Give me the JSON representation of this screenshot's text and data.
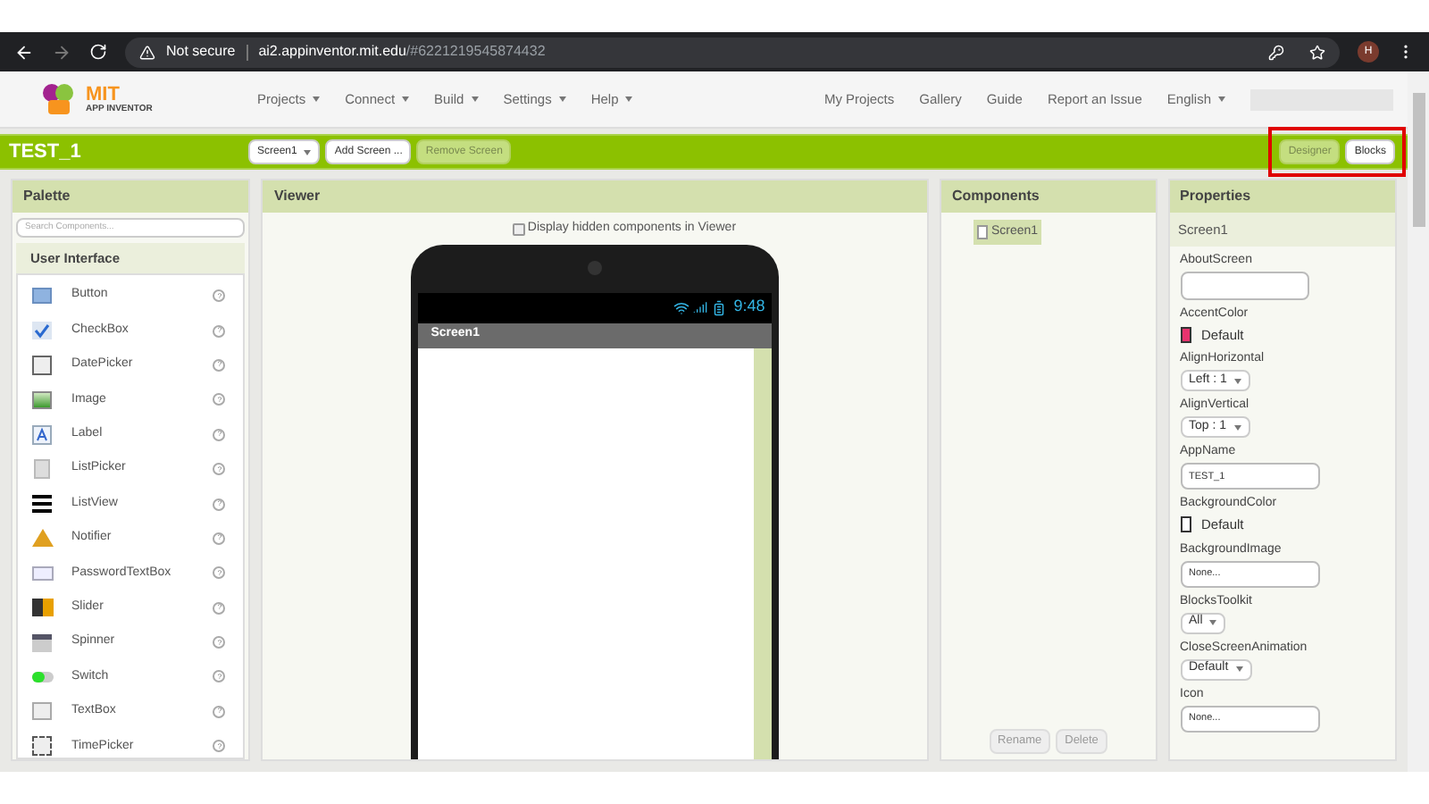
{
  "browser": {
    "security": "Not secure",
    "url_host": "ai2.appinventor.mit.edu",
    "url_rest": "/#6221219545874432",
    "avatar": "H"
  },
  "logo": {
    "title": "MIT",
    "subtitle": "APP INVENTOR"
  },
  "menu": [
    {
      "label": "Projects",
      "dropdown": true
    },
    {
      "label": "Connect",
      "dropdown": true
    },
    {
      "label": "Build",
      "dropdown": true
    },
    {
      "label": "Settings",
      "dropdown": true
    },
    {
      "label": "Help",
      "dropdown": true
    }
  ],
  "links": [
    {
      "label": "My Projects",
      "dropdown": false
    },
    {
      "label": "Gallery",
      "dropdown": false
    },
    {
      "label": "Guide",
      "dropdown": false
    },
    {
      "label": "Report an Issue",
      "dropdown": false
    },
    {
      "label": "English",
      "dropdown": true
    }
  ],
  "project": {
    "title": "TEST_1",
    "screen_select": "Screen1",
    "buttons": [
      {
        "label": "Add Screen ...",
        "disabled": false
      },
      {
        "label": "Remove Screen",
        "disabled": true
      }
    ],
    "modes": [
      {
        "label": "Designer",
        "selected": true
      },
      {
        "label": "Blocks",
        "selected": false
      }
    ]
  },
  "palette": {
    "title": "Palette",
    "search": {
      "placeholder": "Search Components..."
    },
    "group": "User Interface",
    "help": "?",
    "items": [
      {
        "label": "Button"
      },
      {
        "label": "CheckBox"
      },
      {
        "label": "DatePicker"
      },
      {
        "label": "Image"
      },
      {
        "label": "Label"
      },
      {
        "label": "ListPicker"
      },
      {
        "label": "ListView"
      },
      {
        "label": "Notifier"
      },
      {
        "label": "PasswordTextBox"
      },
      {
        "label": "Slider"
      },
      {
        "label": "Spinner"
      },
      {
        "label": "Switch"
      },
      {
        "label": "TextBox"
      },
      {
        "label": "TimePicker"
      }
    ]
  },
  "viewer": {
    "title": "Viewer",
    "hidden_toggle": {
      "label": "Display hidden components in Viewer",
      "checked": false
    },
    "phone": {
      "time": "9:48",
      "screen_title": "Screen1"
    }
  },
  "components": {
    "title": "Components",
    "tree": [
      {
        "label": "Screen1",
        "selected": true
      }
    ],
    "buttons": [
      {
        "label": "Rename",
        "disabled": true
      },
      {
        "label": "Delete",
        "disabled": true
      }
    ]
  },
  "properties": {
    "title": "Properties",
    "subject": "Screen1",
    "items": [
      {
        "kind": "textarea",
        "label": "AboutScreen"
      },
      {
        "kind": "color",
        "label": "AccentColor",
        "value": "Default",
        "color": "#e8336e"
      },
      {
        "kind": "dropdown",
        "label": "AlignHorizontal",
        "value": "Left : 1"
      },
      {
        "kind": "dropdown",
        "label": "AlignVertical",
        "value": "Top : 1"
      },
      {
        "kind": "text",
        "label": "AppName",
        "value": "TEST_1"
      },
      {
        "kind": "color",
        "label": "BackgroundColor",
        "value": "Default",
        "color": "#ffffff"
      },
      {
        "kind": "text",
        "label": "BackgroundImage",
        "value": "None..."
      },
      {
        "kind": "dropdown",
        "label": "BlocksToolkit",
        "value": "All"
      },
      {
        "kind": "dropdown",
        "label": "CloseScreenAnimation",
        "value": "Default"
      },
      {
        "kind": "text",
        "label": "Icon",
        "value": "None..."
      }
    ]
  }
}
